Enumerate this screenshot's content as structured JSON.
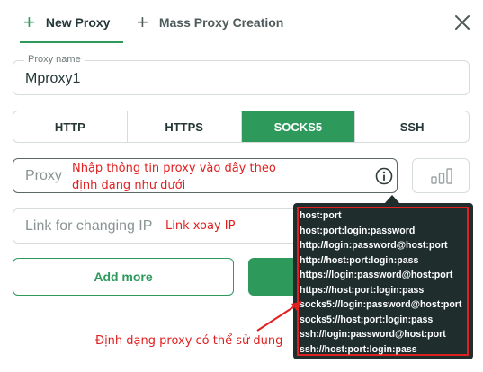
{
  "tabs": [
    {
      "label": "New Proxy",
      "active": true
    },
    {
      "label": "Mass Proxy Creation",
      "active": false
    }
  ],
  "tabs_plus_icon": "+",
  "form": {
    "name_label": "Proxy name",
    "name_value": "Mproxy1",
    "protocols": [
      "HTTP",
      "HTTPS",
      "SOCKS5",
      "SSH"
    ],
    "selected_protocol": "SOCKS5",
    "proxy_placeholder": "Proxy",
    "link_placeholder": "Link for changing IP",
    "add_more_label": "Add more"
  },
  "annotations": {
    "proxy_hint": "Nhập thông tin proxy vào đây theo định dạng như dưới",
    "link_hint": "Link xoay IP",
    "formats_hint": "Định dạng proxy có thể sử dụng"
  },
  "tooltip": {
    "formats": [
      "host:port",
      "host:port:login:password",
      "http://login:password@host:port",
      "http://host:port:login:pass",
      "https://login:password@host:port",
      "https://host:port:login:pass",
      "socks5://login:password@host:port",
      "socks5://host:port:login:pass",
      "ssh://login:password@host:port",
      "ssh://host:port:login:pass"
    ]
  },
  "colors": {
    "accent": "#2d9a5c",
    "annotation": "#e02020",
    "tooltip_bg": "#1f2d2d"
  },
  "icons": [
    "plus-icon",
    "close-icon",
    "info-icon",
    "bar-chart-icon"
  ]
}
